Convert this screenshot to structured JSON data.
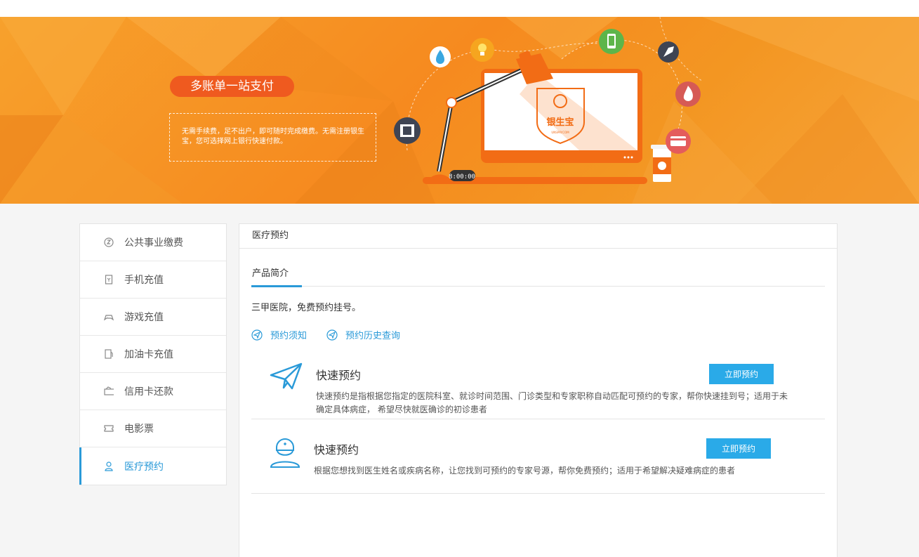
{
  "banner": {
    "pill_text": "多账单一站支付",
    "description": "无需手续费，足不出户，即可随时完成缴费。无需注册银生宝，您可选择网上银行快速付款。",
    "logo_text": "银生宝",
    "logo_sub": "UNSPAY.COM",
    "clock_text": "8:00:00"
  },
  "sidebar": {
    "items": [
      {
        "label": "公共事业缴费",
        "icon": "utility-icon"
      },
      {
        "label": "手机充值",
        "icon": "phone-icon"
      },
      {
        "label": "游戏充值",
        "icon": "gamepad-icon"
      },
      {
        "label": "加油卡充值",
        "icon": "fuel-icon"
      },
      {
        "label": "信用卡还款",
        "icon": "credit-card-icon"
      },
      {
        "label": "电影票",
        "icon": "ticket-icon"
      },
      {
        "label": "医疗预约",
        "icon": "doctor-icon",
        "active": true
      }
    ]
  },
  "panel": {
    "title": "医疗预约",
    "tab": "产品简介",
    "intro": "三甲医院，免费预约挂号。",
    "links": [
      "预约须知",
      "预约历史查询"
    ],
    "services": [
      {
        "title": "快速预约",
        "icon": "paper-plane-icon",
        "description": "快速预约是指根据您指定的医院科室、就诊时间范围、门诊类型和专家职称自动匹配可预约的专家，帮你快速挂到号；适用于未确定具体病症， 希望尽快就医确诊的初诊患者",
        "button": "立即预约"
      },
      {
        "title": "快速预约",
        "icon": "doctor-avatar-icon",
        "description": "根据您想找到医生姓名或疾病名称，让您找到可预约的专家号源，帮你免费预约；适用于希望解决疑难病症的患者",
        "button": "立即预约"
      }
    ]
  },
  "colors": {
    "accent": "#2a9ad8",
    "button": "#2aaae8",
    "banner": "#f68a1f",
    "pill": "#ef5a1f"
  }
}
